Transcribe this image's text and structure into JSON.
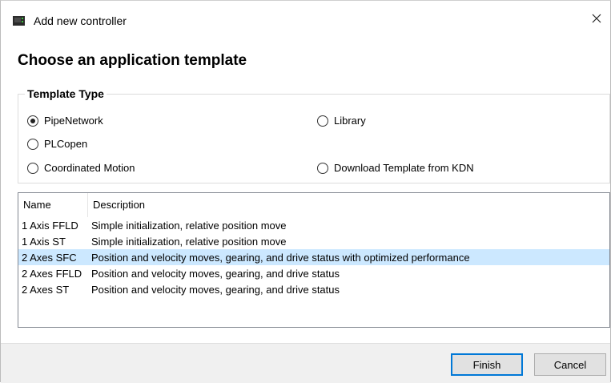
{
  "window": {
    "title": "Add new controller",
    "close_glyph": "✕",
    "icon": "controller-icon"
  },
  "page": {
    "heading": "Choose an application template"
  },
  "template_type": {
    "label": "Template Type",
    "options": [
      {
        "label": "PipeNetwork",
        "checked": true
      },
      {
        "label": "Library",
        "checked": false
      },
      {
        "label": "PLCopen",
        "checked": false
      },
      {
        "label": "Coordinated Motion",
        "checked": false
      },
      {
        "label": "Download Template from KDN",
        "checked": false
      }
    ]
  },
  "template_list": {
    "columns": [
      "Name",
      "Description"
    ],
    "rows": [
      {
        "name": "1 Axis FFLD",
        "description": "Simple initialization, relative position move",
        "selected": false
      },
      {
        "name": "1 Axis ST",
        "description": "Simple initialization, relative position move",
        "selected": false
      },
      {
        "name": "2 Axes SFC",
        "description": "Position and velocity moves, gearing, and drive status with optimized performance",
        "selected": true
      },
      {
        "name": "2 Axes FFLD",
        "description": "Position and velocity moves, gearing, and drive status",
        "selected": false
      },
      {
        "name": "2 Axes ST",
        "description": "Position and velocity moves, gearing, and drive status",
        "selected": false
      }
    ]
  },
  "buttons": {
    "finish": "Finish",
    "cancel": "Cancel"
  },
  "colors": {
    "selection": "#cce8ff",
    "default_button_border": "#0078d7"
  }
}
